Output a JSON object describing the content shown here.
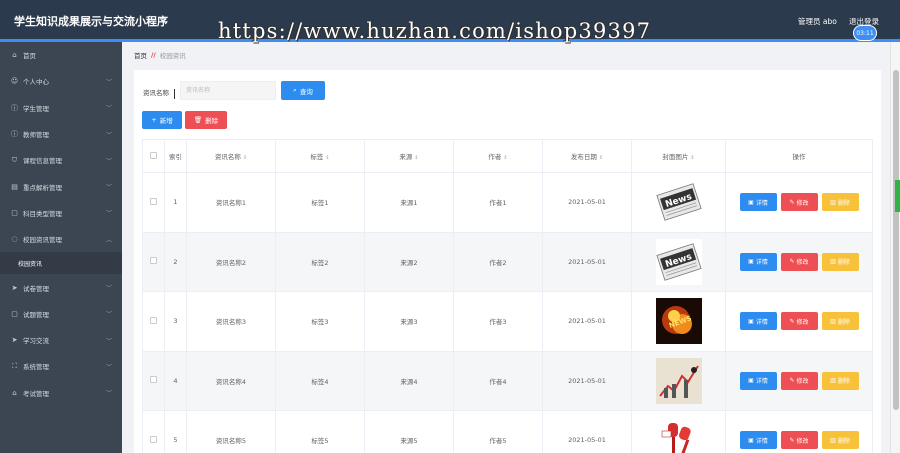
{
  "header": {
    "title": "学生知识成果展示与交流小程序",
    "admin": "管理员 abo",
    "logout": "退出登录",
    "clock": "03:11"
  },
  "watermark": "https://www.huzhan.com/ishop39397",
  "sidebar": {
    "items": [
      {
        "label": "首页",
        "icon": "home-icon"
      },
      {
        "label": "个人中心",
        "icon": "user-icon"
      },
      {
        "label": "学生管理",
        "icon": "info-icon"
      },
      {
        "label": "教师管理",
        "icon": "info-icon"
      },
      {
        "label": "课程信息管理",
        "icon": "filter-icon"
      },
      {
        "label": "重点解析管理",
        "icon": "doc-icon"
      },
      {
        "label": "科目类型管理",
        "icon": "box-icon"
      },
      {
        "label": "校园资讯管理",
        "icon": "bulb-icon"
      },
      {
        "label": "试卷管理",
        "icon": "send-icon"
      },
      {
        "label": "试题管理",
        "icon": "box-icon"
      },
      {
        "label": "学习交流",
        "icon": "send-icon"
      },
      {
        "label": "系统管理",
        "icon": "expand-icon"
      },
      {
        "label": "考试管理",
        "icon": "bank-icon"
      }
    ],
    "sub_item": "校园资讯"
  },
  "breadcrumb": {
    "home": "首页",
    "current": "校园资讯"
  },
  "search": {
    "label": "资讯名称",
    "placeholder": "资讯名称",
    "query_button": "查询"
  },
  "toolbar": {
    "add": "新增",
    "delete": "删除"
  },
  "table": {
    "headers": [
      "索引",
      "资讯名称",
      "标签",
      "来源",
      "作者",
      "发布日期",
      "封面图片",
      "操作"
    ],
    "rows": [
      {
        "index": "1",
        "name": "资讯名称1",
        "tag": "标签1",
        "source": "来源1",
        "author": "作者1",
        "date": "2021-05-01",
        "cover": "news-paper"
      },
      {
        "index": "2",
        "name": "资讯名称2",
        "tag": "标签2",
        "source": "来源2",
        "author": "作者2",
        "date": "2021-05-01",
        "cover": "news-paper"
      },
      {
        "index": "3",
        "name": "资讯名称3",
        "tag": "标签3",
        "source": "来源3",
        "author": "作者3",
        "date": "2021-05-01",
        "cover": "fire-news"
      },
      {
        "index": "4",
        "name": "资讯名称4",
        "tag": "标签4",
        "source": "来源4",
        "author": "作者4",
        "date": "2021-05-01",
        "cover": "chart-graphic"
      },
      {
        "index": "5",
        "name": "资讯名称5",
        "tag": "标签5",
        "source": "来源5",
        "author": "作者5",
        "date": "2021-05-01",
        "cover": "microphones"
      }
    ],
    "actions": {
      "detail": "详情",
      "edit": "修改",
      "remove": "删除"
    }
  },
  "colors": {
    "primary": "#2d8cf0",
    "danger": "#ed4f54",
    "warning": "#f7c23a",
    "header": "#2b3a4d",
    "sidebar": "#3c4653"
  }
}
